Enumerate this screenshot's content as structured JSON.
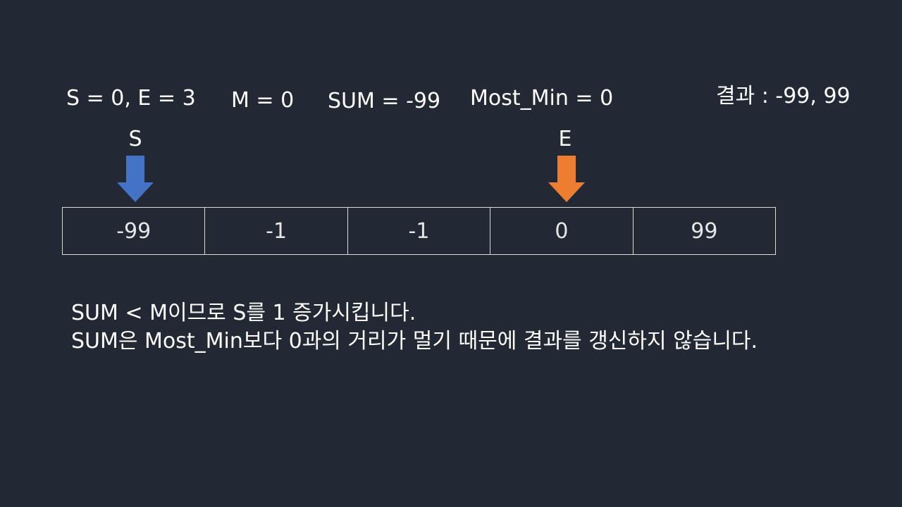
{
  "header": {
    "pointers_text": "S = 0, E = 3",
    "m_text": "M = 0",
    "sum_text": "SUM = -99",
    "most_min_text": "Most_Min = 0",
    "result_text": "결과 : -99, 99"
  },
  "pointers": {
    "start_label": "S",
    "end_label": "E",
    "start_color": "#4472c4",
    "end_color": "#ed7d31",
    "start_index": 0,
    "end_index": 3
  },
  "array": {
    "cells": [
      "-99",
      "-1",
      "-1",
      "0",
      "99"
    ]
  },
  "explanation": {
    "line1": "SUM < M이므로 S를 1 증가시킵니다.",
    "line2": "SUM은 Most_Min보다 0과의 거리가 멀기 때문에 결과를 갱신하지 않습니다."
  },
  "colors": {
    "background": "#222834",
    "grid": "#d9d9d9"
  }
}
